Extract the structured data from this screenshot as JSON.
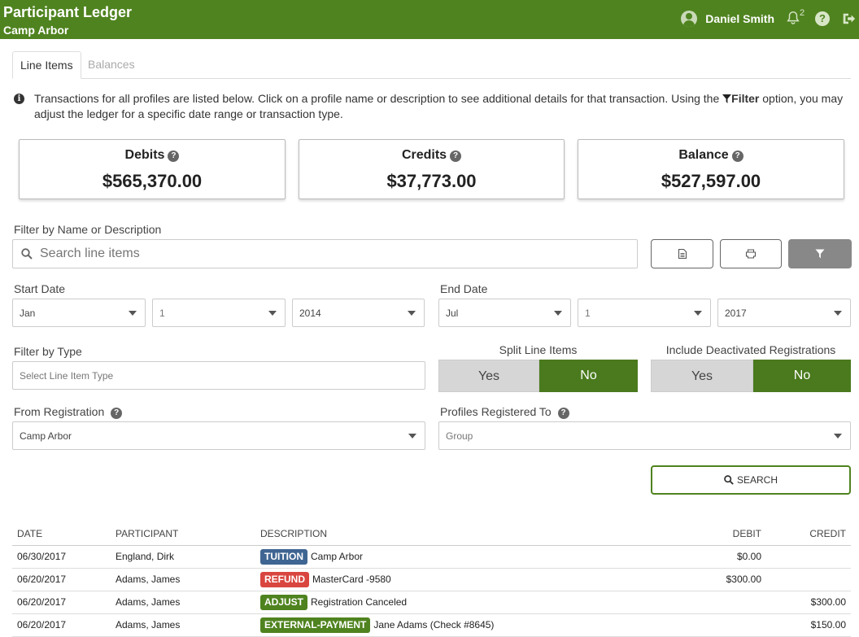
{
  "header": {
    "title": "Participant Ledger",
    "subtitle": "Camp Arbor",
    "user_name": "Daniel Smith",
    "notification_count": "2",
    "help_label": "?"
  },
  "tabs": [
    {
      "label": "Line Items",
      "active": true
    },
    {
      "label": "Balances",
      "active": false
    }
  ],
  "info": {
    "text_before": "Transactions for all profiles are listed below. Click on a profile name or description to see additional details for that transaction. Using the",
    "filter_word": "Filter",
    "text_after": "option, you may adjust the ledger for a specific date range or transaction type."
  },
  "summary": [
    {
      "label": "Debits",
      "value": "$565,370.00"
    },
    {
      "label": "Credits",
      "value": "$37,773.00"
    },
    {
      "label": "Balance",
      "value": "$527,597.00"
    }
  ],
  "filters": {
    "name_label": "Filter by Name or Description",
    "search_placeholder": "Search line items",
    "start_label": "Start Date",
    "start_month": "Jan",
    "start_day": "1",
    "start_year": "2014",
    "end_label": "End Date",
    "end_month": "Jul",
    "end_day": "1",
    "end_year": "2017",
    "type_label": "Filter by Type",
    "type_placeholder": "Select Line Item Type",
    "split_label": "Split Line Items",
    "split_yes": "Yes",
    "split_no": "No",
    "split_selected": "No",
    "deact_label": "Include Deactivated Registrations",
    "deact_yes": "Yes",
    "deact_no": "No",
    "deact_selected": "No",
    "reg_label": "From Registration",
    "reg_value": "Camp Arbor",
    "profiles_label": "Profiles Registered To",
    "profiles_placeholder": "Group",
    "search_button": "SEARCH"
  },
  "table": {
    "headers": [
      "DATE",
      "PARTICIPANT",
      "DESCRIPTION",
      "DEBIT",
      "CREDIT"
    ],
    "rows": [
      {
        "date": "06/30/2017",
        "participant": "England, Dirk",
        "badge": "TUITION",
        "badge_color": "#3f6592",
        "description": "Camp Arbor",
        "debit": "$0.00",
        "credit": ""
      },
      {
        "date": "06/20/2017",
        "participant": "Adams, James",
        "badge": "REFUND",
        "badge_color": "#d9463f",
        "description": "MasterCard -9580",
        "debit": "$300.00",
        "credit": ""
      },
      {
        "date": "06/20/2017",
        "participant": "Adams, James",
        "badge": "ADJUST",
        "badge_color": "#4f831f",
        "description": "Registration Canceled",
        "debit": "",
        "credit": "$300.00"
      },
      {
        "date": "06/20/2017",
        "participant": "Adams, James",
        "badge": "EXTERNAL-PAYMENT",
        "badge_color": "#4f831f",
        "description": "Jane Adams (Check #8645)",
        "debit": "",
        "credit": "$150.00"
      }
    ]
  },
  "colors": {
    "brand": "#4f831f",
    "toggle_active": "#4a7a1d"
  }
}
